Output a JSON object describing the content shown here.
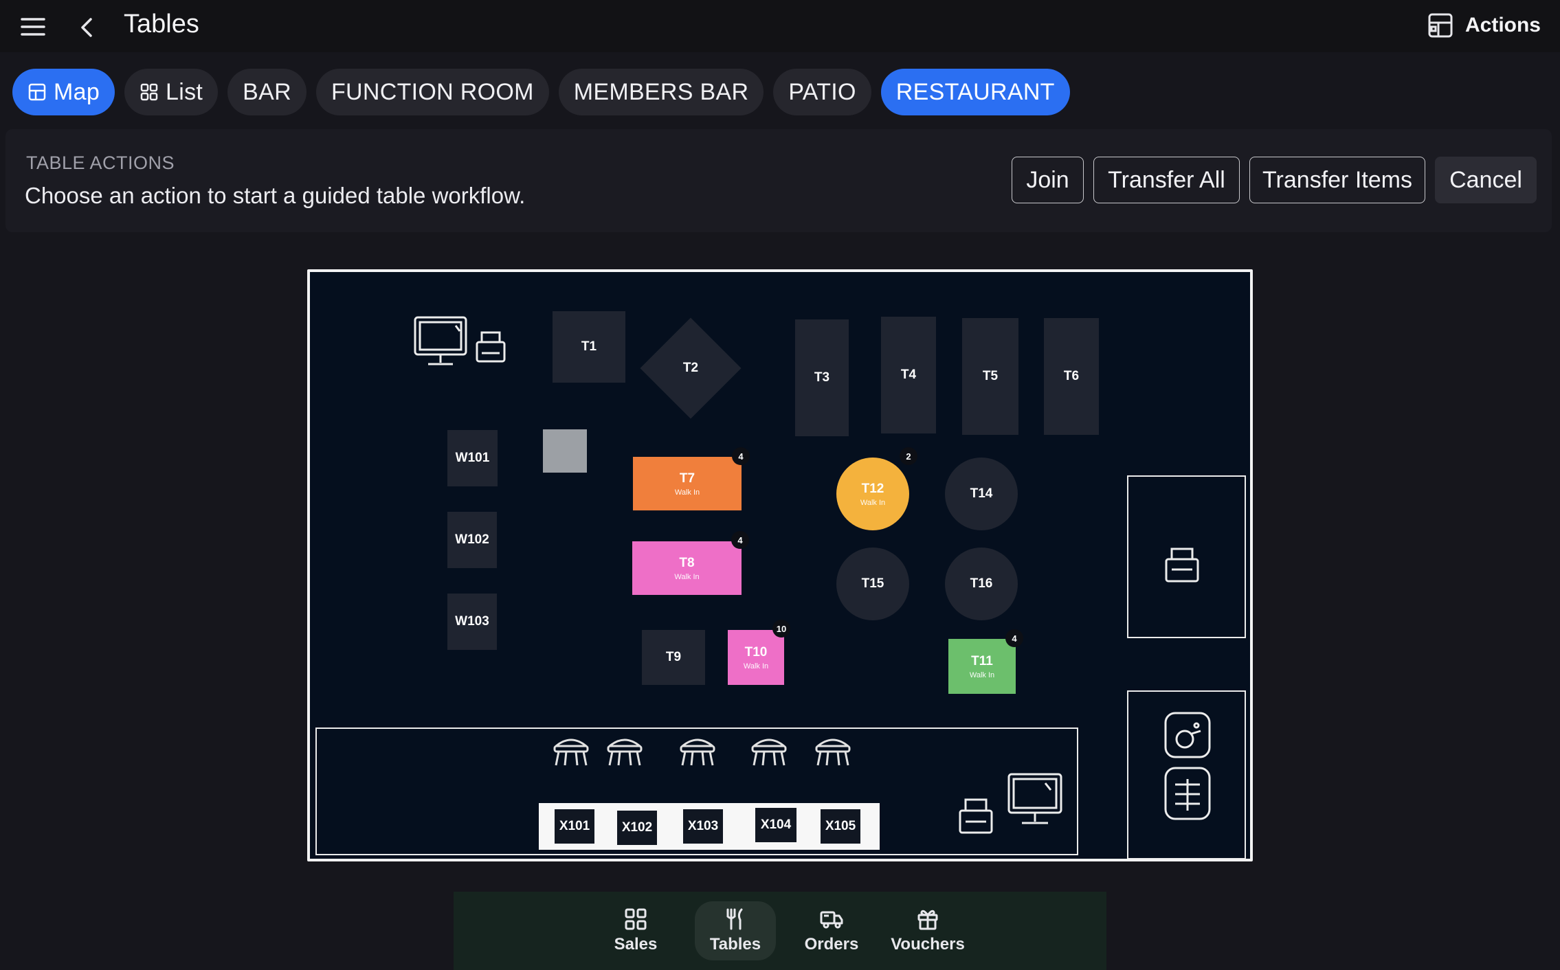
{
  "header": {
    "title": "Tables",
    "actions_label": "Actions"
  },
  "tabs": [
    {
      "label": "Map",
      "active": true,
      "icon": "map-icon"
    },
    {
      "label": "List",
      "active": false,
      "icon": "grid-icon"
    },
    {
      "label": "BAR",
      "active": false
    },
    {
      "label": "FUNCTION ROOM",
      "active": false
    },
    {
      "label": "MEMBERS BAR",
      "active": false
    },
    {
      "label": "PATIO",
      "active": false
    },
    {
      "label": "RESTAURANT",
      "active": true
    }
  ],
  "table_actions": {
    "heading": "TABLE ACTIONS",
    "subtitle": "Choose an action to start a guided table workflow.",
    "buttons": {
      "join": "Join",
      "transfer_all": "Transfer All",
      "transfer_items": "Transfer Items",
      "cancel": "Cancel"
    }
  },
  "floor": {
    "tables": [
      {
        "id": "T1",
        "name": "T1"
      },
      {
        "id": "T2",
        "name": "T2"
      },
      {
        "id": "T3",
        "name": "T3"
      },
      {
        "id": "T4",
        "name": "T4"
      },
      {
        "id": "T5",
        "name": "T5"
      },
      {
        "id": "T6",
        "name": "T6"
      },
      {
        "id": "T7",
        "name": "T7",
        "status": "Walk In",
        "guests": "4",
        "color": "#f07f3c"
      },
      {
        "id": "T8",
        "name": "T8",
        "status": "Walk In",
        "guests": "4",
        "color": "#ee6fc7"
      },
      {
        "id": "T9",
        "name": "T9"
      },
      {
        "id": "T10",
        "name": "T10",
        "status": "Walk In",
        "guests": "10",
        "color": "#ee6fc7"
      },
      {
        "id": "T11",
        "name": "T11",
        "status": "Walk In",
        "guests": "4",
        "color": "#6cbf6c"
      },
      {
        "id": "T12",
        "name": "T12",
        "status": "Walk In",
        "guests": "2",
        "color": "#f4b23d"
      },
      {
        "id": "T14",
        "name": "T14"
      },
      {
        "id": "T15",
        "name": "T15"
      },
      {
        "id": "T16",
        "name": "T16"
      },
      {
        "id": "W101",
        "name": "W101"
      },
      {
        "id": "W102",
        "name": "W102"
      },
      {
        "id": "W103",
        "name": "W103"
      },
      {
        "id": "X101",
        "name": "X101"
      },
      {
        "id": "X102",
        "name": "X102"
      },
      {
        "id": "X103",
        "name": "X103"
      },
      {
        "id": "X104",
        "name": "X104"
      },
      {
        "id": "X105",
        "name": "X105"
      }
    ]
  },
  "bottom_nav": [
    {
      "label": "Sales",
      "icon": "grid-icon",
      "active": false
    },
    {
      "label": "Tables",
      "icon": "utensils-icon",
      "active": true
    },
    {
      "label": "Orders",
      "icon": "delivery-truck-icon",
      "active": false
    },
    {
      "label": "Vouchers",
      "icon": "gift-icon",
      "active": false
    }
  ]
}
